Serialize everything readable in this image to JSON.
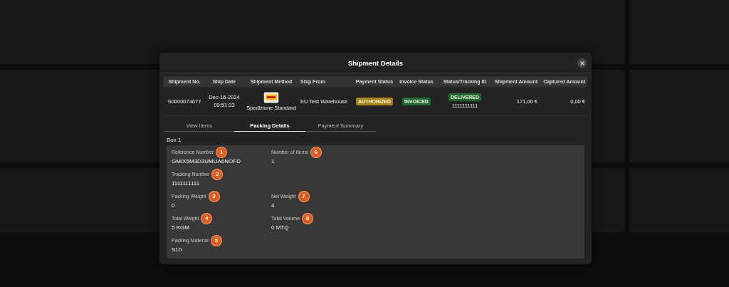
{
  "modal": {
    "title": "Shipment Details",
    "table": {
      "columns": [
        "Shipment No.",
        "Ship Date",
        "Shipment Method",
        "Ship From",
        "Payment Status",
        "Invoice Status",
        "Status/Tracking ID",
        "Shipment Amount",
        "Captured Amount"
      ],
      "rows": [
        {
          "shipment_no": "S0000074677",
          "ship_date": "Dec-16-2024",
          "ship_time": "09:51:33",
          "shipment_method": "Spedizione Standard",
          "ship_from": "EU Test Warehouse",
          "payment_status": {
            "text": "AUTHORIZED",
            "color": "#a98410"
          },
          "invoice_status": {
            "text": "INVOICED",
            "color": "#1d6a2d"
          },
          "delivery_status": {
            "text": "DELIVERED",
            "color": "#1d6a2d"
          },
          "tracking_id": "1111111111",
          "shipment_amount": "171,00 €",
          "captured_amount": "0,00 €"
        }
      ]
    },
    "tabs": [
      {
        "label": "View Items",
        "selected": false
      },
      {
        "label": "Packing Details",
        "selected": true
      },
      {
        "label": "Payment Summary",
        "selected": false
      }
    ],
    "box": {
      "title": "Box 1",
      "rows": [
        [
          {
            "label": "Reference Number",
            "value": "GMIX5M3D3UMUA6NOFD",
            "marker": "1"
          },
          {
            "label": "Number of Items",
            "value": "1",
            "marker": "6"
          }
        ],
        [
          {
            "label": "Tracking Number",
            "value": "1111111111",
            "marker": "2"
          }
        ],
        [
          {
            "label": "Packing Weight",
            "value": "0",
            "marker": "3"
          },
          {
            "label": "Net Weight",
            "value": "4",
            "marker": "7"
          }
        ],
        [
          {
            "label": "Total Weight",
            "value": "5 KGM",
            "marker": "4"
          },
          {
            "label": "Total Volume",
            "value": "0 MTQ",
            "marker": "8"
          }
        ],
        [
          {
            "label": "Packing Material",
            "value": "S10",
            "marker": "5"
          }
        ]
      ]
    }
  }
}
